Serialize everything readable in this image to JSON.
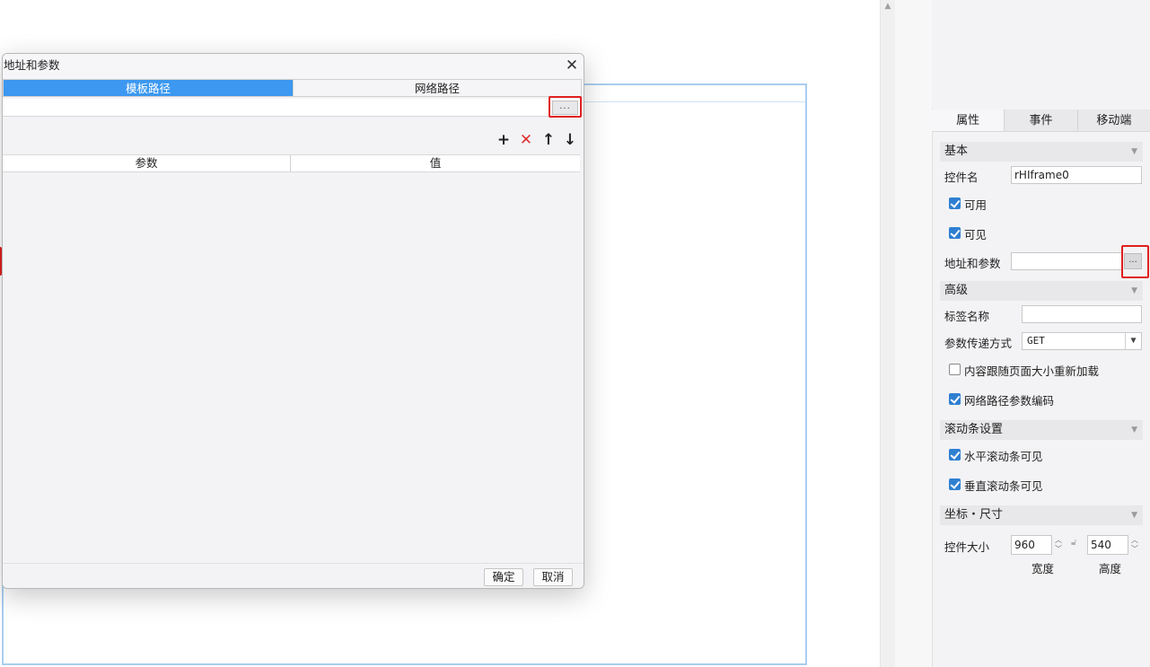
{
  "dialog": {
    "title": "地址和参数",
    "close_glyph": "✕",
    "tabs": [
      {
        "label": "模板路径",
        "active": true
      },
      {
        "label": "网络路径",
        "active": false
      }
    ],
    "path_value": "",
    "browse_label": "...",
    "toolbar": {
      "add_glyph": "+",
      "delete_glyph": "✕",
      "up_glyph": "↑",
      "down_glyph": "↓"
    },
    "grid_columns": [
      "参数",
      "值"
    ],
    "ok_label": "确定",
    "cancel_label": "取消"
  },
  "panel": {
    "tabs": [
      {
        "label": "属性",
        "active": true
      },
      {
        "label": "事件",
        "active": false
      },
      {
        "label": "移动端",
        "active": false
      }
    ],
    "basic": {
      "header": "基本",
      "control_name_label": "控件名",
      "control_name_value": "rHIframe0",
      "enabled_label": "可用",
      "enabled": true,
      "visible_label": "可见",
      "visible": true,
      "address_label": "地址和参数",
      "address_value": "",
      "address_browse": "..."
    },
    "advanced": {
      "header": "高级",
      "tag_name_label": "标签名称",
      "tag_name_value": "",
      "param_method_label": "参数传递方式",
      "param_method_value": "GET",
      "reload_label": "内容跟随页面大小重新加载",
      "reload": false,
      "encode_label": "网络路径参数编码",
      "encode": true
    },
    "scroll": {
      "header": "滚动条设置",
      "h_label": "水平滚动条可见",
      "h": true,
      "v_label": "垂直滚动条可见",
      "v": true
    },
    "geometry": {
      "header": "坐标・尺寸",
      "size_label": "控件大小",
      "width_value": "960",
      "height_value": "540",
      "width_caption": "宽度",
      "height_caption": "高度"
    }
  },
  "colors": {
    "accent": "#3c98f0",
    "highlight_red": "#e02020",
    "checkbox_blue": "#2f7fd1"
  }
}
